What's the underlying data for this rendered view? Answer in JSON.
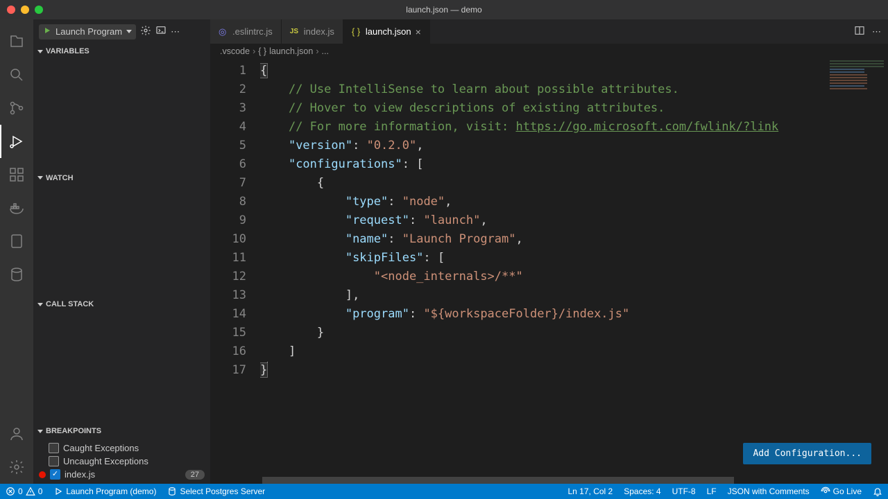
{
  "window": {
    "title": "launch.json — demo"
  },
  "run": {
    "dropdown_label": "Launch Program"
  },
  "sections": {
    "variables": "Variables",
    "watch": "Watch",
    "callstack": "Call Stack",
    "breakpoints": "Breakpoints"
  },
  "breakpoints": {
    "caught": "Caught Exceptions",
    "uncaught": "Uncaught Exceptions",
    "file": "index.js",
    "line": "27"
  },
  "tabs": [
    {
      "label": ".eslintrc.js",
      "type": "eslint"
    },
    {
      "label": "index.js",
      "type": "js"
    },
    {
      "label": "launch.json",
      "type": "json",
      "active": true
    }
  ],
  "breadcrumbs": {
    "seg1": ".vscode",
    "seg2": "launch.json",
    "seg3": "..."
  },
  "editor": {
    "lines": [
      {
        "n": 1,
        "html": "<span class='tok-p cursor-brace'>{</span>"
      },
      {
        "n": 2,
        "html": "    <span class='tok-c'>// Use IntelliSense to learn about possible attributes.</span>"
      },
      {
        "n": 3,
        "html": "    <span class='tok-c'>// Hover to view descriptions of existing attributes.</span>"
      },
      {
        "n": 4,
        "html": "    <span class='tok-c'>// For more information, visit: </span><span class='tok-url'>https://go.microsoft.com/fwlink/?link</span>"
      },
      {
        "n": 5,
        "html": "    <span class='tok-k'>\"version\"</span><span class='tok-p'>: </span><span class='tok-s'>\"0.2.0\"</span><span class='tok-p'>,</span>"
      },
      {
        "n": 6,
        "html": "    <span class='tok-k'>\"configurations\"</span><span class='tok-p'>: [</span>"
      },
      {
        "n": 7,
        "html": "        <span class='tok-p'>{</span>"
      },
      {
        "n": 8,
        "html": "            <span class='tok-k'>\"type\"</span><span class='tok-p'>: </span><span class='tok-s'>\"node\"</span><span class='tok-p'>,</span>"
      },
      {
        "n": 9,
        "html": "            <span class='tok-k'>\"request\"</span><span class='tok-p'>: </span><span class='tok-s'>\"launch\"</span><span class='tok-p'>,</span>"
      },
      {
        "n": 10,
        "html": "            <span class='tok-k'>\"name\"</span><span class='tok-p'>: </span><span class='tok-s'>\"Launch Program\"</span><span class='tok-p'>,</span>"
      },
      {
        "n": 11,
        "html": "            <span class='tok-k'>\"skipFiles\"</span><span class='tok-p'>: [</span>"
      },
      {
        "n": 12,
        "html": "                <span class='tok-s'>\"&lt;node_internals&gt;/**\"</span>"
      },
      {
        "n": 13,
        "html": "            <span class='tok-p'>],</span>"
      },
      {
        "n": 14,
        "html": "            <span class='tok-k'>\"program\"</span><span class='tok-p'>: </span><span class='tok-s'>\"${workspaceFolder}/index.js\"</span>"
      },
      {
        "n": 15,
        "html": "        <span class='tok-p'>}</span>"
      },
      {
        "n": 16,
        "html": "    <span class='tok-p'>]</span>"
      },
      {
        "n": 17,
        "html": "<span class='tok-p cursor-brace'>}</span><span class='text-cursor'></span>"
      }
    ]
  },
  "add_config": "Add Configuration...",
  "status": {
    "errors": "0",
    "warnings": "0",
    "launch": "Launch Program (demo)",
    "postgres": "Select Postgres Server",
    "ln_col": "Ln 17, Col 2",
    "spaces": "Spaces: 4",
    "encoding": "UTF-8",
    "eol": "LF",
    "lang": "JSON with Comments",
    "golive": "Go Live"
  }
}
